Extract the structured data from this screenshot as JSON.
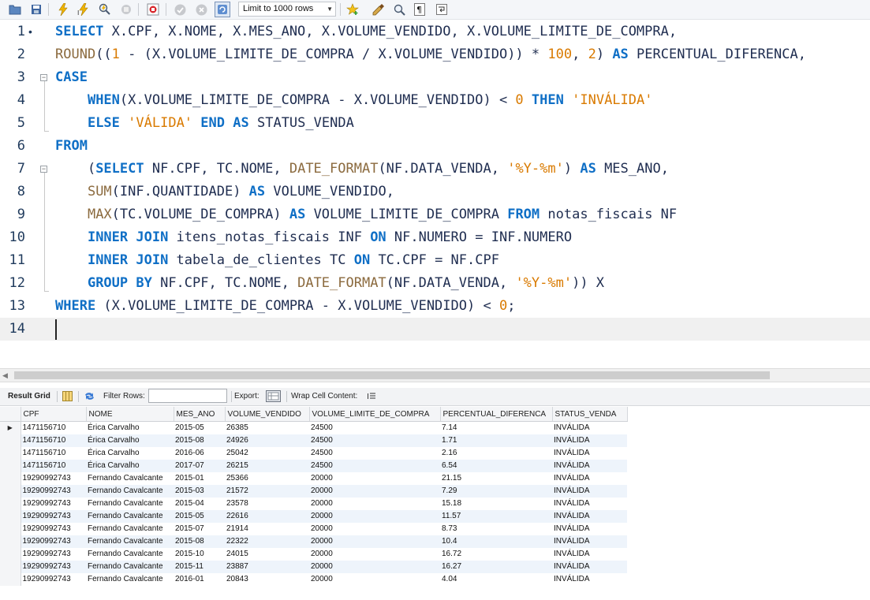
{
  "toolbar": {
    "limit_select": "Limit to 1000 rows",
    "icons": [
      "folder-open-icon",
      "save-icon",
      "execute-lightning-icon",
      "execute-cursor-lightning-icon",
      "explain-magnifier-icon",
      "stop-hand-icon",
      "toggle-error-stop-icon",
      "commit-check-icon",
      "rollback-cancel-icon",
      "autocommit-icon",
      "favorite-star-icon",
      "beautify-broom-icon",
      "find-magnifier-icon",
      "invisible-chars-icon",
      "wrap-lines-icon"
    ]
  },
  "editor": {
    "line_numbers": [
      "1",
      "2",
      "3",
      "4",
      "5",
      "6",
      "7",
      "8",
      "9",
      "10",
      "11",
      "12",
      "13",
      "14"
    ],
    "lines": [
      [
        [
          "kw",
          "SELECT"
        ],
        [
          "id",
          " X.CPF, X.NOME, X.MES_ANO, X.VOLUME_VENDIDO, X.VOLUME_LIMITE_DE_COMPRA,"
        ]
      ],
      [
        [
          "fn",
          "ROUND"
        ],
        [
          "id",
          "(("
        ],
        [
          "num",
          "1"
        ],
        [
          "id",
          " - (X.VOLUME_LIMITE_DE_COMPRA / X.VOLUME_VENDIDO)) * "
        ],
        [
          "num",
          "100"
        ],
        [
          "id",
          ", "
        ],
        [
          "num",
          "2"
        ],
        [
          "id",
          ") "
        ],
        [
          "kw",
          "AS"
        ],
        [
          "id",
          " PERCENTUAL_DIFERENCA,"
        ]
      ],
      [
        [
          "kw",
          "CASE"
        ]
      ],
      [
        [
          "id",
          "    "
        ],
        [
          "kw",
          "WHEN"
        ],
        [
          "id",
          "(X.VOLUME_LIMITE_DE_COMPRA - X.VOLUME_VENDIDO) < "
        ],
        [
          "num",
          "0"
        ],
        [
          "id",
          " "
        ],
        [
          "kw",
          "THEN"
        ],
        [
          "id",
          " "
        ],
        [
          "str",
          "'INVÁLIDA'"
        ]
      ],
      [
        [
          "id",
          "    "
        ],
        [
          "kw",
          "ELSE"
        ],
        [
          "id",
          " "
        ],
        [
          "str",
          "'VÁLIDA'"
        ],
        [
          "id",
          " "
        ],
        [
          "kw",
          "END"
        ],
        [
          "id",
          " "
        ],
        [
          "kw",
          "AS"
        ],
        [
          "id",
          " STATUS_VENDA"
        ]
      ],
      [
        [
          "kw",
          "FROM"
        ]
      ],
      [
        [
          "id",
          "    ("
        ],
        [
          "kw",
          "SELECT"
        ],
        [
          "id",
          " NF.CPF, TC.NOME, "
        ],
        [
          "fn",
          "DATE_FORMAT"
        ],
        [
          "id",
          "(NF.DATA_VENDA, "
        ],
        [
          "str",
          "'%Y-%m'"
        ],
        [
          "id",
          ") "
        ],
        [
          "kw",
          "AS"
        ],
        [
          "id",
          " MES_ANO,"
        ]
      ],
      [
        [
          "id",
          "    "
        ],
        [
          "fn",
          "SUM"
        ],
        [
          "id",
          "(INF.QUANTIDADE) "
        ],
        [
          "kw",
          "AS"
        ],
        [
          "id",
          " VOLUME_VENDIDO,"
        ]
      ],
      [
        [
          "id",
          "    "
        ],
        [
          "fn",
          "MAX"
        ],
        [
          "id",
          "(TC.VOLUME_DE_COMPRA) "
        ],
        [
          "kw",
          "AS"
        ],
        [
          "id",
          " VOLUME_LIMITE_DE_COMPRA "
        ],
        [
          "kw",
          "FROM"
        ],
        [
          "id",
          " notas_fiscais NF"
        ]
      ],
      [
        [
          "id",
          "    "
        ],
        [
          "kw",
          "INNER JOIN"
        ],
        [
          "id",
          " itens_notas_fiscais INF "
        ],
        [
          "kw",
          "ON"
        ],
        [
          "id",
          " NF.NUMERO = INF.NUMERO"
        ]
      ],
      [
        [
          "id",
          "    "
        ],
        [
          "kw",
          "INNER JOIN"
        ],
        [
          "id",
          " tabela_de_clientes TC "
        ],
        [
          "kw",
          "ON"
        ],
        [
          "id",
          " TC.CPF = NF.CPF"
        ]
      ],
      [
        [
          "id",
          "    "
        ],
        [
          "kw",
          "GROUP BY"
        ],
        [
          "id",
          " NF.CPF, TC.NOME, "
        ],
        [
          "fn",
          "DATE_FORMAT"
        ],
        [
          "id",
          "(NF.DATA_VENDA, "
        ],
        [
          "str",
          "'%Y-%m'"
        ],
        [
          "id",
          ")) X"
        ]
      ],
      [
        [
          "kw",
          "WHERE"
        ],
        [
          "id",
          " (X.VOLUME_LIMITE_DE_COMPRA - X.VOLUME_VENDIDO) < "
        ],
        [
          "num",
          "0"
        ],
        [
          "id",
          ";"
        ]
      ],
      []
    ]
  },
  "result_toolbar": {
    "result_grid_label": "Result Grid",
    "filter_rows_label": "Filter Rows:",
    "filter_rows_value": "",
    "export_label": "Export:",
    "wrap_cell_label": "Wrap Cell Content:"
  },
  "grid": {
    "columns": [
      "CPF",
      "NOME",
      "MES_ANO",
      "VOLUME_VENDIDO",
      "VOLUME_LIMITE_DE_COMPRA",
      "PERCENTUAL_DIFERENCA",
      "STATUS_VENDA"
    ],
    "rows": [
      [
        "1471156710",
        "Érica Carvalho",
        "2015-05",
        "26385",
        "24500",
        "7.14",
        "INVÁLIDA"
      ],
      [
        "1471156710",
        "Érica Carvalho",
        "2015-08",
        "24926",
        "24500",
        "1.71",
        "INVÁLIDA"
      ],
      [
        "1471156710",
        "Érica Carvalho",
        "2016-06",
        "25042",
        "24500",
        "2.16",
        "INVÁLIDA"
      ],
      [
        "1471156710",
        "Érica Carvalho",
        "2017-07",
        "26215",
        "24500",
        "6.54",
        "INVÁLIDA"
      ],
      [
        "19290992743",
        "Fernando Cavalcante",
        "2015-01",
        "25366",
        "20000",
        "21.15",
        "INVÁLIDA"
      ],
      [
        "19290992743",
        "Fernando Cavalcante",
        "2015-03",
        "21572",
        "20000",
        "7.29",
        "INVÁLIDA"
      ],
      [
        "19290992743",
        "Fernando Cavalcante",
        "2015-04",
        "23578",
        "20000",
        "15.18",
        "INVÁLIDA"
      ],
      [
        "19290992743",
        "Fernando Cavalcante",
        "2015-05",
        "22616",
        "20000",
        "11.57",
        "INVÁLIDA"
      ],
      [
        "19290992743",
        "Fernando Cavalcante",
        "2015-07",
        "21914",
        "20000",
        "8.73",
        "INVÁLIDA"
      ],
      [
        "19290992743",
        "Fernando Cavalcante",
        "2015-08",
        "22322",
        "20000",
        "10.4",
        "INVÁLIDA"
      ],
      [
        "19290992743",
        "Fernando Cavalcante",
        "2015-10",
        "24015",
        "20000",
        "16.72",
        "INVÁLIDA"
      ],
      [
        "19290992743",
        "Fernando Cavalcante",
        "2015-11",
        "23887",
        "20000",
        "16.27",
        "INVÁLIDA"
      ],
      [
        "19290992743",
        "Fernando Cavalcante",
        "2016-01",
        "20843",
        "20000",
        "4.04",
        "INVÁLIDA"
      ]
    ]
  },
  "colors": {
    "keyword": "#0f6fc6",
    "function": "#8b6a3e",
    "literal": "#d97a00",
    "identifier": "#1f2d50",
    "grid_alt_row": "#eef4fb"
  }
}
